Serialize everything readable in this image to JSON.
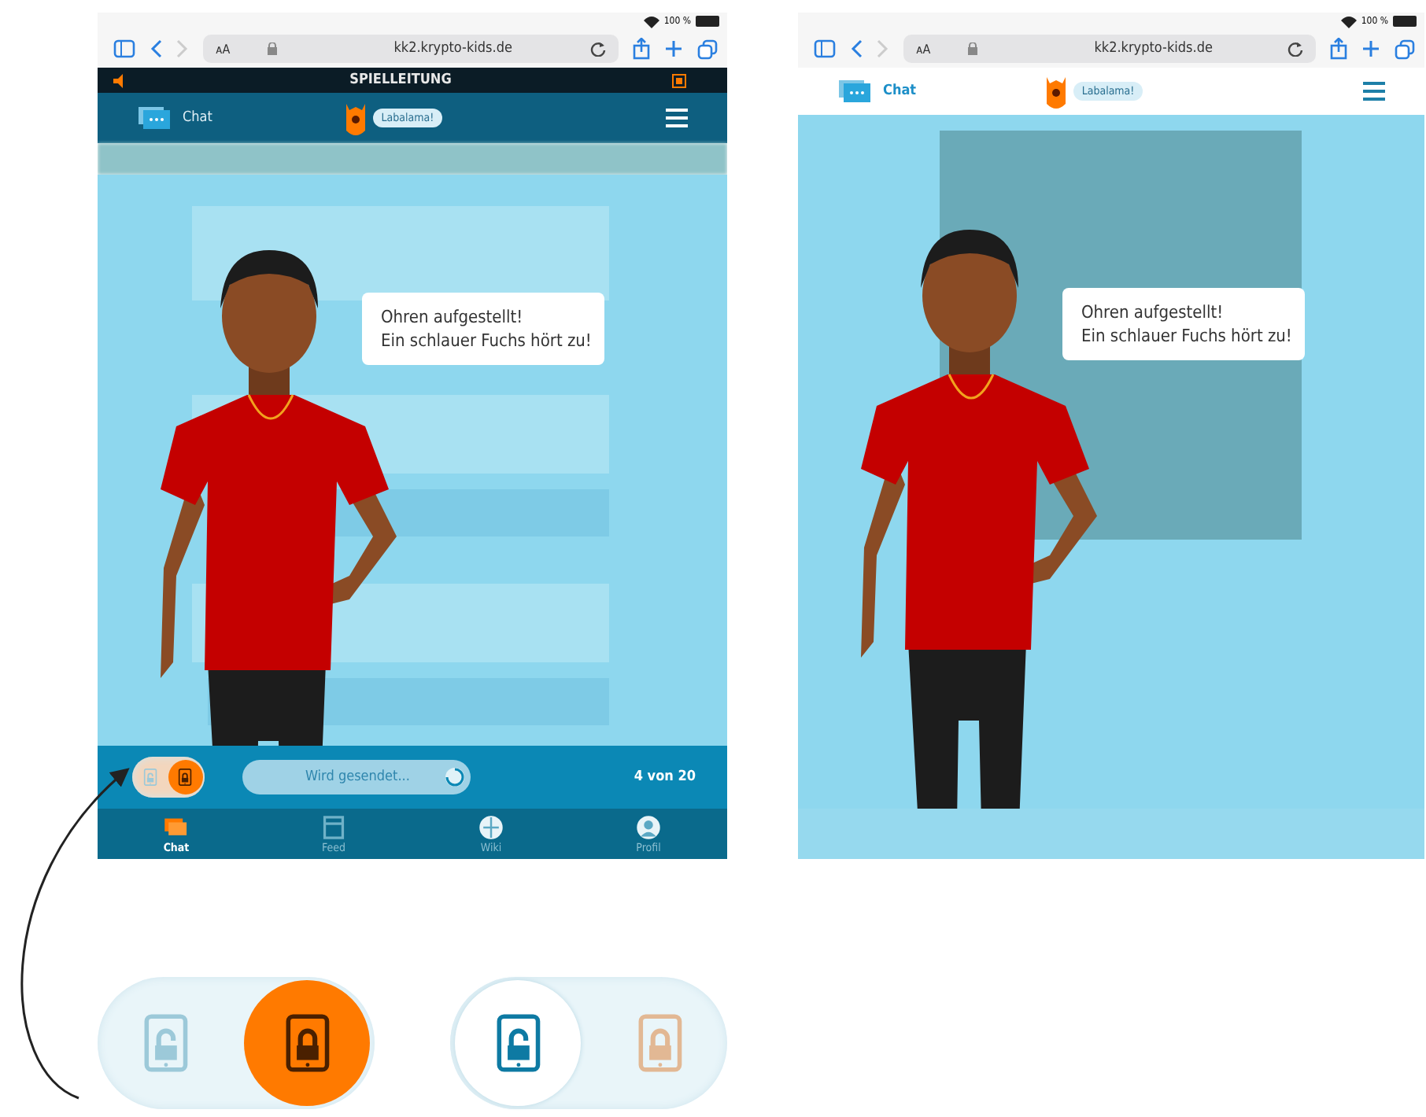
{
  "screens": [
    {
      "kind": "chat",
      "status": {
        "battery": "100 %"
      },
      "browser": {
        "text_size": "ᴀA",
        "url": "kk2.krypto-kids.de"
      },
      "game_bar": {
        "title": "SPIELLEITUNG"
      },
      "header": {
        "chat": "Chat",
        "bubble": "Labalama!"
      },
      "speech": [
        "Ohren aufgestellt!",
        "Ein schlauer Fuchs hört zu!"
      ],
      "send_bar": {
        "lock_toggle": [
          {
            "kind": "unlocked",
            "selected": false
          },
          {
            "kind": "locked",
            "selected": true
          }
        ],
        "field": "Wird gesendet...",
        "counter": "4 von 20"
      },
      "tabs": [
        {
          "label": "Chat",
          "kind": "chat",
          "selected": true
        },
        {
          "label": "Feed",
          "kind": "feed",
          "selected": false
        },
        {
          "label": "Wiki",
          "kind": "wiki",
          "selected": false
        },
        {
          "label": "Profil",
          "kind": "profile",
          "selected": false
        }
      ]
    },
    {
      "kind": "video",
      "status": {
        "battery": "100 %"
      },
      "browser": {
        "text_size": "ᴀA",
        "url": "kk2.krypto-kids.de"
      },
      "header": {
        "chat": "Chat",
        "bubble": "Labalama!"
      },
      "speech": [
        "Ohren aufgestellt!",
        "Ein schlauer Fuchs hört zu!"
      ]
    }
  ],
  "toggles": [
    [
      {
        "kind": "unlocked",
        "selected": false
      },
      {
        "kind": "locked",
        "selected": true
      }
    ],
    [
      {
        "kind": "unlocked",
        "selected": true
      },
      {
        "kind": "locked",
        "selected": false
      }
    ]
  ]
}
